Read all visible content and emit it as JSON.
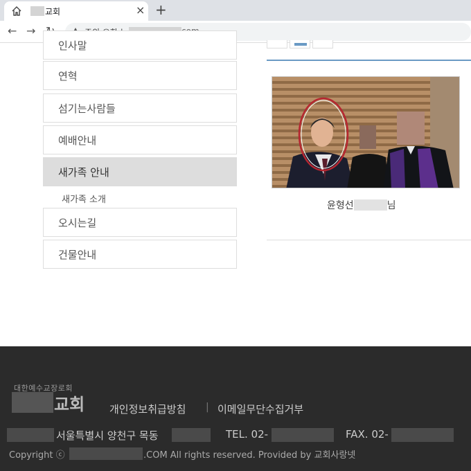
{
  "browser": {
    "tab_title": "교회",
    "close_glyph": "×",
    "new_tab_glyph": "+",
    "back_glyph": "←",
    "forward_glyph": "→",
    "reload_glyph": "↻",
    "security_warning": "주의 요함 |",
    "url_suffix": "com"
  },
  "sidebar": {
    "items": [
      {
        "label": "인사말"
      },
      {
        "label": "연혁"
      },
      {
        "label": "섬기는사람들"
      },
      {
        "label": "예배안내"
      },
      {
        "label": "새가족 안내",
        "active": true
      },
      {
        "label": "오시는길"
      },
      {
        "label": "건물안내"
      }
    ],
    "sub_item": "새가족 소개"
  },
  "content": {
    "caption_prefix": "윤형선",
    "caption_suffix": "님",
    "rule_color": "#6a9ac4"
  },
  "footer": {
    "logo_small": "대한예수교장로회",
    "logo_text": "교회",
    "link_privacy": "개인정보취급방침",
    "separator": "|",
    "link_email": "이메일무단수집거부",
    "address": "서울특별시 양천구 목동",
    "tel": "TEL. 02-",
    "fax": "FAX. 02-",
    "copyright_prefix": "Copyright ⓒ",
    "copyright_suffix": ".COM All rights reserved.  Provided by 교회사랑넷"
  }
}
